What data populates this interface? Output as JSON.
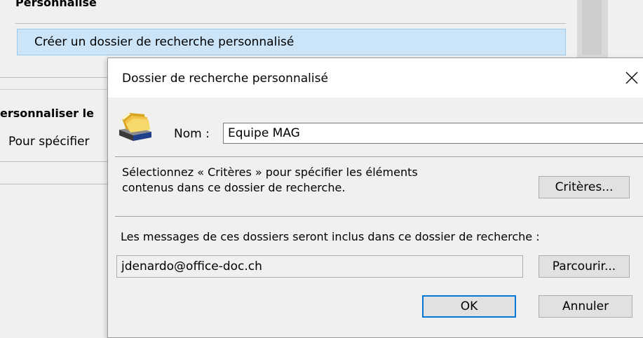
{
  "background": {
    "section_header": "Personnalise",
    "selected_item": "Créer un dossier de recherche personnalisé",
    "heading": "ersonnaliser le",
    "text": "Pour spécifier"
  },
  "dialog": {
    "title": "Dossier de recherche personnalisé",
    "close_icon": "close-icon",
    "folder_icon": "search-folder-icon",
    "name_label": "Nom :",
    "name_value": "Equipe MAG",
    "criteria_text_line1": "Sélectionnez « Critères » pour spécifier les éléments",
    "criteria_text_line2": "contenus dans ce dossier de recherche.",
    "criteria_button": "Critères...",
    "messages_label": "Les messages de ces dossiers seront inclus dans ce dossier de recherche :",
    "folder_value": "jdenardo@office-doc.ch",
    "browse_button": "Parcourir...",
    "ok_button": "OK",
    "cancel_button": "Annuler"
  },
  "colors": {
    "selection": "#cce4f7",
    "ok_border": "#0078d7",
    "button_bg": "#e1e1e1"
  }
}
